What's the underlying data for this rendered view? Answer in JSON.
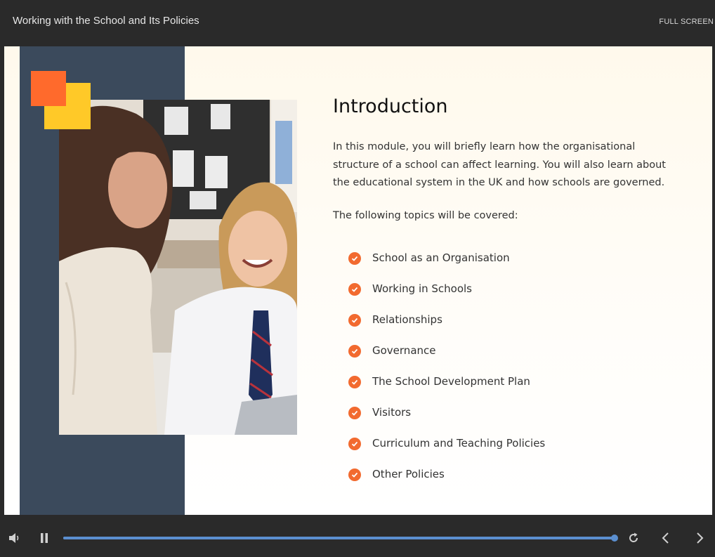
{
  "header": {
    "course_title": "Working with the School and Its Policies",
    "fullscreen_label": "FULL SCREEN"
  },
  "slide": {
    "heading": "Introduction",
    "intro_text": "In this module, you will briefly learn how the organisational structure of a school can affect learning. You will also learn about the educational system in the UK and how schools are governed.",
    "topics_lead": "The following topics will be covered:",
    "topics": [
      "School as an Organisation",
      "Working in Schools",
      "Relationships",
      "Governance",
      "The School Development Plan",
      "Visitors",
      "Curriculum and Teaching Policies",
      "Other Policies"
    ],
    "colors": {
      "side_panel": "#3b4a5c",
      "accent_orange": "#ff6a2c",
      "accent_yellow": "#ffc928",
      "check": "#f26a2f"
    },
    "photo": "teacher-and-student-photo"
  },
  "player": {
    "progress": 1.0,
    "icons": [
      "volume-icon",
      "pause-icon",
      "replay-icon",
      "chevron-left-icon",
      "chevron-right-icon"
    ],
    "accent": "#5b8fd0"
  }
}
